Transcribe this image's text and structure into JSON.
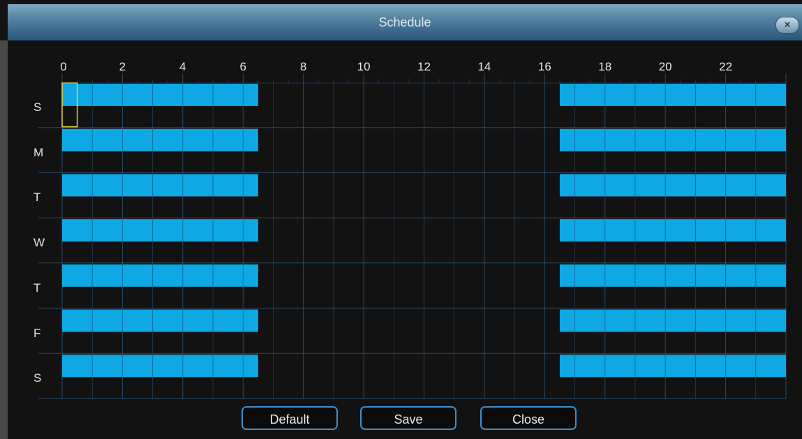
{
  "window": {
    "title": "Schedule",
    "close_glyph": "×"
  },
  "schedule": {
    "hour_labels": [
      "0",
      "2",
      "4",
      "6",
      "8",
      "10",
      "12",
      "14",
      "16",
      "18",
      "20",
      "22"
    ],
    "days": [
      "S",
      "M",
      "T",
      "W",
      "T",
      "F",
      "S"
    ],
    "half_hour_slots_per_day": 48,
    "active_ranges_hours": [
      [
        0,
        6.5
      ],
      [
        16.5,
        24
      ]
    ],
    "selected_slot": {
      "day_index": 0,
      "slot": 0
    },
    "colors": {
      "active": "#0ea8e4",
      "grid": "#2a4a66",
      "selection": "#e6d33a"
    }
  },
  "buttons": {
    "default_label": "Default",
    "save_label": "Save",
    "close_label": "Close"
  }
}
